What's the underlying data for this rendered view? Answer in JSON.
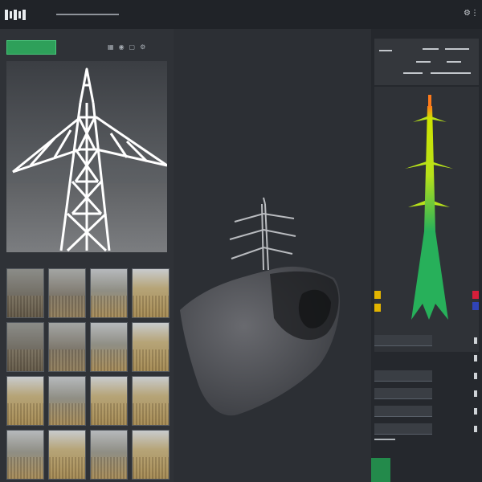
{
  "app": {
    "title": "",
    "accent": "#2ea05a"
  },
  "left": {
    "green_button_label": "",
    "tool_icons": [
      "grid-icon",
      "camera-icon",
      "frame-icon",
      "settings-icon"
    ],
    "thumbnails": [
      {
        "id": "t0"
      },
      {
        "id": "t1"
      },
      {
        "id": "t2"
      },
      {
        "id": "t3"
      },
      {
        "id": "t0"
      },
      {
        "id": "t1"
      },
      {
        "id": "t2"
      },
      {
        "id": "t3"
      },
      {
        "id": "t3"
      },
      {
        "id": "t2"
      },
      {
        "id": "t3"
      },
      {
        "id": "t3"
      },
      {
        "id": "t2"
      },
      {
        "id": "t3"
      },
      {
        "id": "t2"
      },
      {
        "id": "t3"
      }
    ]
  },
  "right": {
    "header_labels": [
      "",
      "",
      ""
    ],
    "properties": [
      {
        "key": "",
        "value": ""
      },
      {
        "key": "",
        "value": ""
      },
      {
        "key": "",
        "value": ""
      },
      {
        "key": "",
        "value": ""
      },
      {
        "key": "",
        "value": ""
      },
      {
        "key": "",
        "value": ""
      }
    ],
    "gradient_colors": [
      "#ff7a1a",
      "#cfe400",
      "#27b05a"
    ]
  }
}
